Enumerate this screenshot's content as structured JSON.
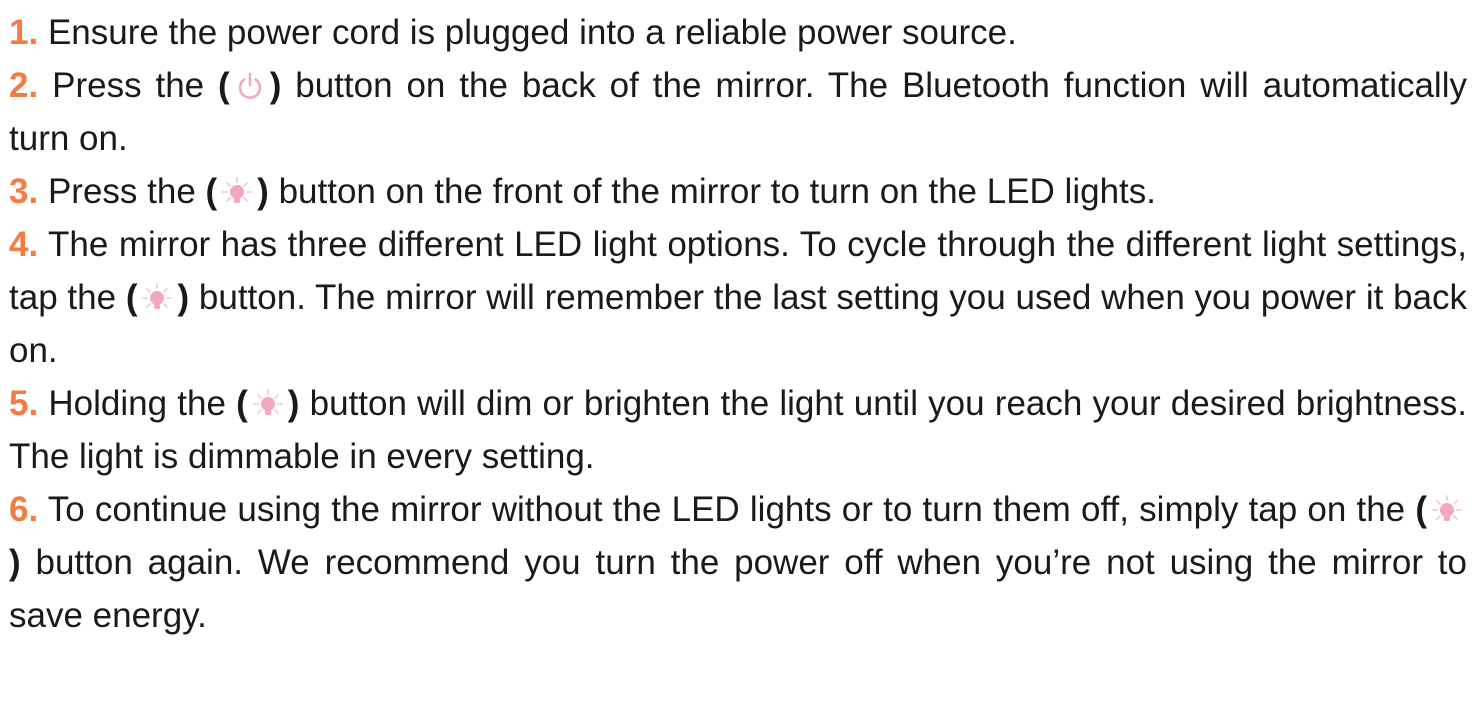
{
  "steps": [
    {
      "number": "1.",
      "parts": [
        "Ensure the power cord is plugged into a reliable power source."
      ]
    },
    {
      "number": "2.",
      "parts": [
        "Press the ",
        " button on the back of the mirror. The Bluetooth function will automatically turn on."
      ],
      "icon": "power-icon"
    },
    {
      "number": "3.",
      "parts": [
        "Press the ",
        " button on the front of the mirror to turn on the LED lights."
      ],
      "icon": "light-bulb-icon"
    },
    {
      "number": "4.",
      "parts": [
        "The mirror has three different LED light options. To cycle through the different light settings, tap the ",
        " button. The mirror will remember the last setting you used when you power it back on."
      ],
      "icon": "light-bulb-icon"
    },
    {
      "number": "5.",
      "parts": [
        "Holding the ",
        " button will dim or brighten the light until you reach your desired brightness. The light is dimmable in every setting."
      ],
      "icon": "light-bulb-icon"
    },
    {
      "number": "6.",
      "parts": [
        "To continue using the mirror without the LED lights or to turn them off, simply tap on the ",
        " button again. We recommend you turn the power off when you’re not using the mirror to save energy."
      ],
      "icon": "light-bulb-icon"
    }
  ],
  "paren_open": "(",
  "paren_close": ")",
  "colors": {
    "number": "#f47b42",
    "icon_pink": "#f2a7c3",
    "icon_pink_light": "#f7c9da",
    "text": "#1a1a1a"
  }
}
